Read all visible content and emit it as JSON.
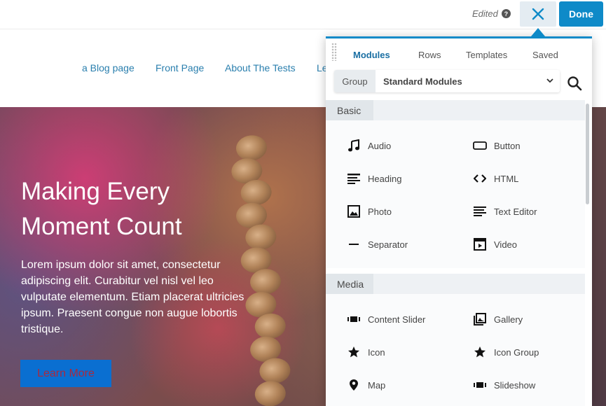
{
  "topbar": {
    "edited_label": "Edited",
    "help_icon": "?",
    "close_icon": "close-icon",
    "done_label": "Done",
    "accent": "#0e8ac8"
  },
  "site_nav": {
    "links": [
      "a Blog page",
      "Front Page",
      "About The Tests",
      "Le"
    ],
    "link_color": "#2a7fae"
  },
  "hero": {
    "title": "Making Every Moment Count",
    "body": "Lorem ipsum dolor sit amet, consectetur adipiscing elit. Curabitur vel nisl vel leo vulputate elementum. Etiam placerat ultricies ipsum. Praesent congue non augue lobortis tristique.",
    "button_label": "Learn More",
    "button_color": "#0a6fd1",
    "button_text_color": "#a82a3f"
  },
  "panel": {
    "tabs": [
      "Modules",
      "Rows",
      "Templates",
      "Saved"
    ],
    "active_tab": "Modules",
    "group_label": "Group",
    "group_value": "Standard Modules",
    "sections": [
      {
        "title": "Basic",
        "modules": [
          {
            "label": "Audio",
            "icon": "music-note-icon"
          },
          {
            "label": "Button",
            "icon": "button-icon"
          },
          {
            "label": "Heading",
            "icon": "heading-icon"
          },
          {
            "label": "HTML",
            "icon": "code-icon"
          },
          {
            "label": "Photo",
            "icon": "photo-icon"
          },
          {
            "label": "Text Editor",
            "icon": "text-editor-icon"
          },
          {
            "label": "Separator",
            "icon": "separator-icon"
          },
          {
            "label": "Video",
            "icon": "video-icon"
          }
        ]
      },
      {
        "title": "Media",
        "modules": [
          {
            "label": "Content Slider",
            "icon": "slider-icon"
          },
          {
            "label": "Gallery",
            "icon": "gallery-icon"
          },
          {
            "label": "Icon",
            "icon": "star-icon"
          },
          {
            "label": "Icon Group",
            "icon": "star-icon"
          },
          {
            "label": "Map",
            "icon": "map-pin-icon"
          },
          {
            "label": "Slideshow",
            "icon": "slider-icon"
          }
        ]
      }
    ]
  }
}
